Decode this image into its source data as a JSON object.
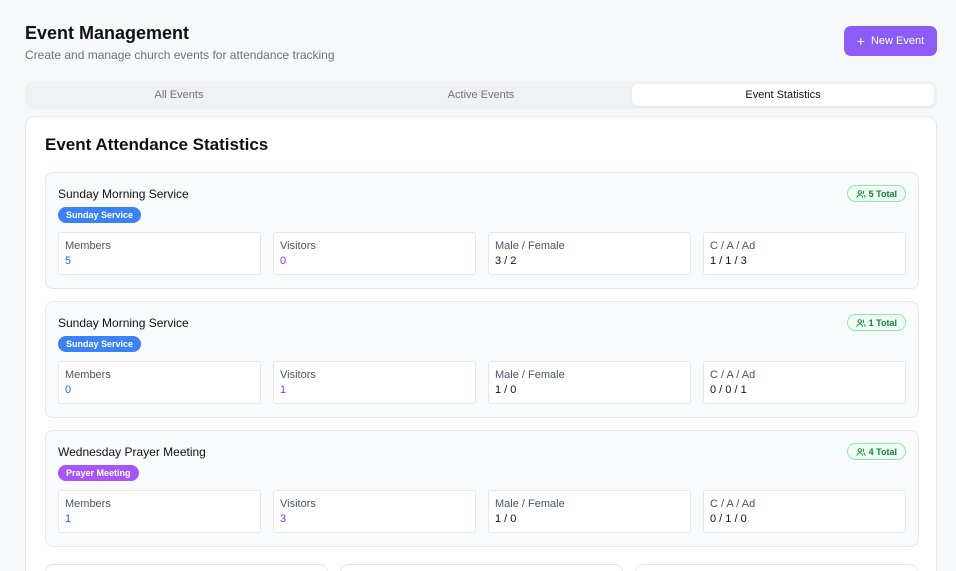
{
  "header": {
    "title": "Event Management",
    "subtitle": "Create and manage church events for attendance tracking",
    "new_event_label": "New Event"
  },
  "tabs": [
    {
      "label": "All Events",
      "active": false
    },
    {
      "label": "Active Events",
      "active": false
    },
    {
      "label": "Event Statistics",
      "active": true
    }
  ],
  "panel": {
    "title": "Event Attendance Statistics",
    "events": [
      {
        "name": "Sunday Morning Service",
        "type": "Sunday Service",
        "type_color": "#3b82f6",
        "total": "5 Total",
        "stats": {
          "members_label": "Members",
          "members": "5",
          "visitors_label": "Visitors",
          "visitors": "0",
          "gender_label": "Male / Female",
          "gender": "3 / 2",
          "age_label": "C / A / Ad",
          "age": "1 / 1 / 3"
        }
      },
      {
        "name": "Sunday Morning Service",
        "type": "Sunday Service",
        "type_color": "#3b82f6",
        "total": "1 Total",
        "stats": {
          "members_label": "Members",
          "members": "0",
          "visitors_label": "Visitors",
          "visitors": "1",
          "gender_label": "Male / Female",
          "gender": "1 / 0",
          "age_label": "C / A / Ad",
          "age": "0 / 0 / 1"
        }
      },
      {
        "name": "Wednesday Prayer Meeting",
        "type": "Prayer Meeting",
        "type_color": "#a855f7",
        "total": "4 Total",
        "stats": {
          "members_label": "Members",
          "members": "1",
          "visitors_label": "Visitors",
          "visitors": "3",
          "gender_label": "Male / Female",
          "gender": "1 / 0",
          "age_label": "C / A / Ad",
          "age": "0 / 1 / 0"
        }
      }
    ]
  },
  "colors": {
    "accent": "#8b5cf6",
    "members_value": "#2563eb",
    "visitors_value": "#9333ea",
    "total_badge": "#15803d"
  },
  "icons": {
    "new_event": "plus-icon",
    "total": "users-icon"
  }
}
